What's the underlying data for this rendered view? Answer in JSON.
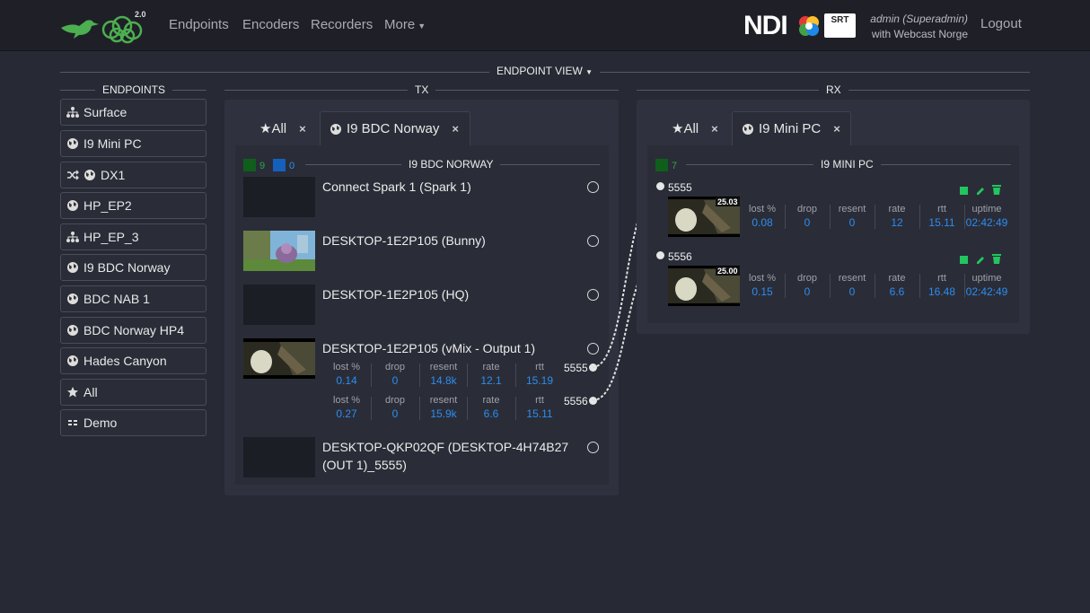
{
  "navbar": {
    "logo_version": "2.0",
    "links": [
      "Endpoints",
      "Encoders",
      "Recorders",
      "More"
    ],
    "ndi_label": "NDI",
    "srt_label": "SRT",
    "user_role": "admin (Superadmin)",
    "user_org": "with Webcast Norge",
    "logout": "Logout"
  },
  "endpoint_view": {
    "title": "ENDPOINT VIEW"
  },
  "sidebar": {
    "title": "ENDPOINTS",
    "items": [
      {
        "label": "Surface",
        "icon": "network-icon"
      },
      {
        "label": "I9 Mini PC",
        "icon": "globe-icon"
      },
      {
        "label": "DX1",
        "icon": "shuffle-globe-icon"
      },
      {
        "label": "HP_EP2",
        "icon": "globe-icon"
      },
      {
        "label": "HP_EP_3",
        "icon": "network-icon"
      },
      {
        "label": "I9 BDC Norway",
        "icon": "globe-icon"
      },
      {
        "label": "BDC NAB 1",
        "icon": "globe-icon"
      },
      {
        "label": "BDC Norway HP4",
        "icon": "globe-icon"
      },
      {
        "label": "Hades Canyon",
        "icon": "globe-icon"
      },
      {
        "label": "All",
        "icon": "star-icon"
      },
      {
        "label": "Demo",
        "icon": "grid-icon"
      }
    ]
  },
  "tx": {
    "title": "TX",
    "tabs": [
      {
        "label": "★All",
        "close": "×"
      },
      {
        "label": "I9 BDC Norway",
        "close": "×"
      }
    ],
    "section_title": "I9 BDC NORWAY",
    "count_green": "9",
    "count_blue": "0",
    "sources": [
      {
        "name": "Connect Spark 1 (Spark 1)"
      },
      {
        "name": "DESKTOP-1E2P105 (Bunny)"
      },
      {
        "name": "DESKTOP-1E2P105 (HQ)"
      },
      {
        "name": "DESKTOP-1E2P105 (vMix - Output 1)"
      },
      {
        "name": "DESKTOP-QKP02QF (DESKTOP-4H74B27 (OUT 1)_5555)"
      }
    ],
    "streams": [
      {
        "port": "5555",
        "lost": "0.14",
        "drop": "0",
        "resent": "14.8k",
        "rate": "12.1",
        "rtt": "15.19"
      },
      {
        "port": "5556",
        "lost": "0.27",
        "drop": "0",
        "resent": "15.9k",
        "rate": "6.6",
        "rtt": "15.11"
      }
    ],
    "stat_labels": {
      "lost": "lost %",
      "drop": "drop",
      "resent": "resent",
      "rate": "rate",
      "rtt": "rtt"
    }
  },
  "rx": {
    "title": "RX",
    "tabs": [
      {
        "label": "★All",
        "close": "×"
      },
      {
        "label": "I9 Mini PC",
        "close": "×"
      }
    ],
    "section_title": "I9 MINI PC",
    "count_green": "7",
    "streams": [
      {
        "port": "5555",
        "fps": "25.03",
        "lost": "0.08",
        "drop": "0",
        "resent": "0",
        "rate": "12",
        "rtt": "15.11",
        "uptime": "02:42:49"
      },
      {
        "port": "5556",
        "fps": "25.00",
        "lost": "0.15",
        "drop": "0",
        "resent": "0",
        "rate": "6.6",
        "rtt": "16.48",
        "uptime": "02:42:49"
      }
    ],
    "stat_labels": {
      "lost": "lost %",
      "drop": "drop",
      "resent": "resent",
      "rate": "rate",
      "rtt": "rtt",
      "uptime": "uptime"
    }
  },
  "colors": {
    "accent_blue": "#2d8cf0",
    "status_green": "#22c55e",
    "bg": "#272a35"
  }
}
